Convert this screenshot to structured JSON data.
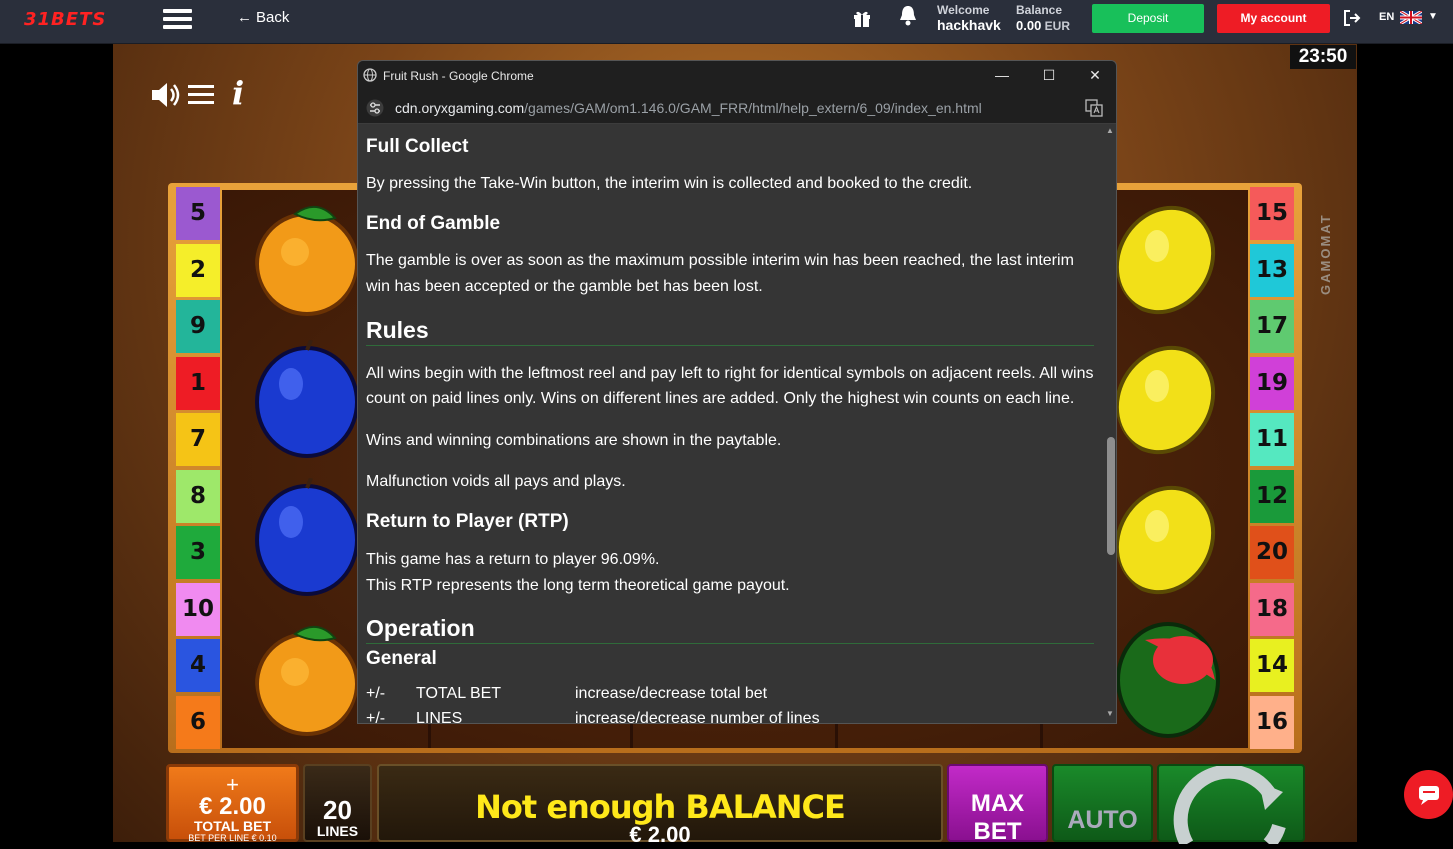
{
  "site": {
    "logo_text": "31BETS",
    "back_label": "Back",
    "welcome_label": "Welcome",
    "username": "hackhavk",
    "balance_label": "Balance",
    "balance_value": "0.00",
    "balance_currency": "EUR",
    "deposit_label": "Deposit",
    "account_label": "My account",
    "language": "EN"
  },
  "game": {
    "clock": "23:50",
    "brand": "GAMOMAT",
    "left_line_numbers": [
      "5",
      "2",
      "9",
      "1",
      "7",
      "8",
      "3",
      "10",
      "4",
      "6"
    ],
    "left_line_colors": [
      "#9b59d0",
      "#f5ee2a",
      "#23b59a",
      "#ee1c25",
      "#f5c416",
      "#9ee86a",
      "#1faa3c",
      "#f08af0",
      "#2a55e0",
      "#f57a1a"
    ],
    "right_line_numbers": [
      "15",
      "13",
      "17",
      "19",
      "11",
      "12",
      "20",
      "18",
      "14",
      "16"
    ],
    "right_line_colors": [
      "#f55a5a",
      "#1fc8d8",
      "#5fca70",
      "#d040d8",
      "#55e8c0",
      "#1a9a3a",
      "#e0501a",
      "#f56a8a",
      "#e8f020",
      "#ffb08a"
    ],
    "total_bet_plus": "+",
    "total_bet_amount": "€ 2.00",
    "total_bet_label": "TOTAL BET",
    "total_bet_sub": "BET PER LINE € 0.10",
    "lines_count": "20",
    "lines_label": "LINES",
    "message": "Not enough BALANCE",
    "message_sub": "€ 2.00",
    "maxbet_label": "MAX BET",
    "auto_label": "AUTO"
  },
  "popup": {
    "window_title": "Fruit Rush - Google Chrome",
    "url_host": "cdn.oryxgaming.com",
    "url_path": "/games/GAM/om1.146.0/GAM_FRR/html/help_extern/6_09/index_en.html",
    "win_minimize": "—",
    "win_maximize": "☐",
    "win_close": "✕",
    "content": {
      "full_collect_heading": "Full Collect",
      "full_collect_text": "By pressing the Take-Win button, the interim win is collected and booked to the credit.",
      "end_gamble_heading": "End of Gamble",
      "end_gamble_text_1": "The gamble is over as soon as the maximum possible interim win has been reached, the last interim",
      "end_gamble_text_2": "win has been accepted or the gamble bet has been lost.",
      "rules_heading": "Rules",
      "rules_text_1": "All wins begin with the leftmost reel and pay left to right for identical symbols on adjacent reels. All wins",
      "rules_text_2": "count on paid lines only. Wins on different lines are added. Only the highest win counts on each line.",
      "rules_text_3": "Wins and winning combinations are shown in the paytable.",
      "rules_text_4": "Malfunction voids all pays and plays.",
      "rtp_heading": "Return to Player (RTP)",
      "rtp_text_1": "This game has a return to player 96.09%.",
      "rtp_text_2": "This RTP represents the long term theoretical game payout.",
      "operation_heading": "Operation",
      "general_heading": "General",
      "table": [
        {
          "key": "+/-",
          "name": "TOTAL BET",
          "desc": "increase/decrease total bet"
        },
        {
          "key": "+/-",
          "name": "LINES",
          "desc": "increase/decrease number of lines"
        }
      ]
    }
  }
}
